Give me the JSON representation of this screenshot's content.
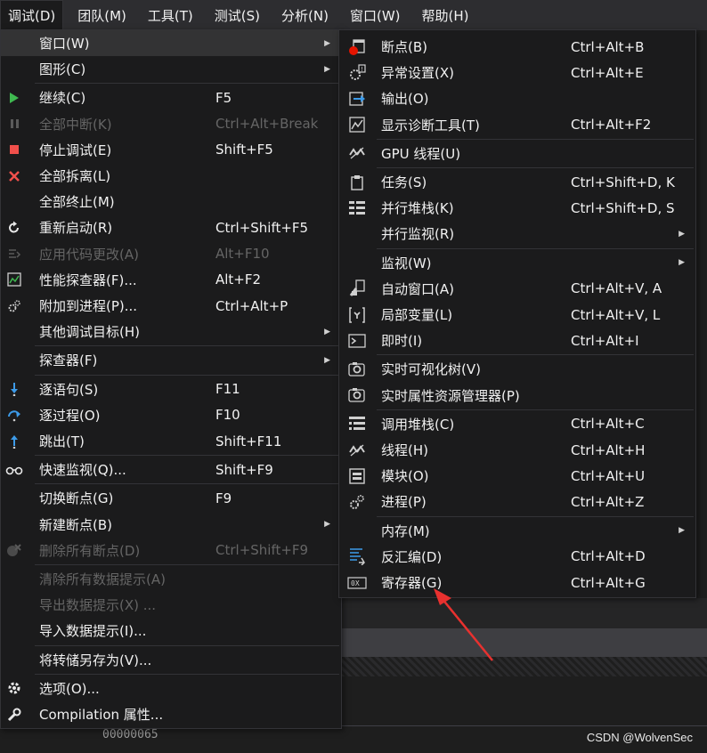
{
  "menubar": {
    "items": [
      "调试(D)",
      "团队(M)",
      "工具(T)",
      "测试(S)",
      "分析(N)",
      "窗口(W)",
      "帮助(H)"
    ]
  },
  "debug_menu": {
    "items": [
      {
        "label": "窗口(W)",
        "shortcut": "",
        "submenu": true,
        "disabled": false,
        "icon": "none"
      },
      {
        "label": "图形(C)",
        "shortcut": "",
        "submenu": true,
        "disabled": false,
        "icon": "none"
      },
      {
        "label": "继续(C)",
        "shortcut": "F5",
        "submenu": false,
        "disabled": false,
        "icon": "continue-icon"
      },
      {
        "label": "全部中断(K)",
        "shortcut": "Ctrl+Alt+Break",
        "submenu": false,
        "disabled": true,
        "icon": "pause-icon"
      },
      {
        "label": "停止调试(E)",
        "shortcut": "Shift+F5",
        "submenu": false,
        "disabled": false,
        "icon": "stop-icon"
      },
      {
        "label": "全部拆离(L)",
        "shortcut": "",
        "submenu": false,
        "disabled": false,
        "icon": "detach-icon"
      },
      {
        "label": "全部终止(M)",
        "shortcut": "",
        "submenu": false,
        "disabled": false,
        "icon": "none"
      },
      {
        "label": "重新启动(R)",
        "shortcut": "Ctrl+Shift+F5",
        "submenu": false,
        "disabled": false,
        "icon": "restart-icon"
      },
      {
        "label": "应用代码更改(A)",
        "shortcut": "Alt+F10",
        "submenu": false,
        "disabled": true,
        "icon": "apply-code-icon"
      },
      {
        "label": "性能探查器(F)...",
        "shortcut": "Alt+F2",
        "submenu": false,
        "disabled": false,
        "icon": "profiler-icon"
      },
      {
        "label": "附加到进程(P)...",
        "shortcut": "Ctrl+Alt+P",
        "submenu": false,
        "disabled": false,
        "icon": "attach-icon"
      },
      {
        "label": "其他调试目标(H)",
        "shortcut": "",
        "submenu": true,
        "disabled": false,
        "icon": "none"
      },
      {
        "label": "探查器(F)",
        "shortcut": "",
        "submenu": true,
        "disabled": false,
        "icon": "none"
      },
      {
        "label": "逐语句(S)",
        "shortcut": "F11",
        "submenu": false,
        "disabled": false,
        "icon": "step-into-icon"
      },
      {
        "label": "逐过程(O)",
        "shortcut": "F10",
        "submenu": false,
        "disabled": false,
        "icon": "step-over-icon"
      },
      {
        "label": "跳出(T)",
        "shortcut": "Shift+F11",
        "submenu": false,
        "disabled": false,
        "icon": "step-out-icon"
      },
      {
        "label": "快速监视(Q)...",
        "shortcut": "Shift+F9",
        "submenu": false,
        "disabled": false,
        "icon": "quickwatch-icon"
      },
      {
        "label": "切换断点(G)",
        "shortcut": "F9",
        "submenu": false,
        "disabled": false,
        "icon": "none"
      },
      {
        "label": "新建断点(B)",
        "shortcut": "",
        "submenu": true,
        "disabled": false,
        "icon": "none"
      },
      {
        "label": "删除所有断点(D)",
        "shortcut": "Ctrl+Shift+F9",
        "submenu": false,
        "disabled": true,
        "icon": "delete-breakpoints-icon"
      },
      {
        "label": "清除所有数据提示(A)",
        "shortcut": "",
        "submenu": false,
        "disabled": true,
        "icon": "none"
      },
      {
        "label": "导出数据提示(X) ...",
        "shortcut": "",
        "submenu": false,
        "disabled": true,
        "icon": "none"
      },
      {
        "label": "导入数据提示(I)...",
        "shortcut": "",
        "submenu": false,
        "disabled": false,
        "icon": "none"
      },
      {
        "label": "将转储另存为(V)...",
        "shortcut": "",
        "submenu": false,
        "disabled": false,
        "icon": "none"
      },
      {
        "label": "选项(O)...",
        "shortcut": "",
        "submenu": false,
        "disabled": false,
        "icon": "gear-icon"
      },
      {
        "label": "Compilation 属性...",
        "shortcut": "",
        "submenu": false,
        "disabled": false,
        "icon": "wrench-icon"
      }
    ]
  },
  "window_submenu": {
    "items": [
      {
        "label": "断点(B)",
        "shortcut": "Ctrl+Alt+B",
        "submenu": false,
        "icon": "breakpoints-icon"
      },
      {
        "label": "异常设置(X)",
        "shortcut": "Ctrl+Alt+E",
        "submenu": false,
        "icon": "exception-settings-icon"
      },
      {
        "label": "输出(O)",
        "shortcut": "",
        "submenu": false,
        "icon": "output-icon"
      },
      {
        "label": "显示诊断工具(T)",
        "shortcut": "Ctrl+Alt+F2",
        "submenu": false,
        "icon": "diagnostic-tools-icon"
      },
      {
        "label": "GPU 线程(U)",
        "shortcut": "",
        "submenu": false,
        "icon": "gpu-threads-icon"
      },
      {
        "label": "任务(S)",
        "shortcut": "Ctrl+Shift+D, K",
        "submenu": false,
        "icon": "tasks-icon"
      },
      {
        "label": "并行堆栈(K)",
        "shortcut": "Ctrl+Shift+D, S",
        "submenu": false,
        "icon": "parallel-stacks-icon"
      },
      {
        "label": "并行监视(R)",
        "shortcut": "",
        "submenu": true,
        "icon": "none"
      },
      {
        "label": "监视(W)",
        "shortcut": "",
        "submenu": true,
        "icon": "none"
      },
      {
        "label": "自动窗口(A)",
        "shortcut": "Ctrl+Alt+V, A",
        "submenu": false,
        "icon": "autos-icon"
      },
      {
        "label": "局部变量(L)",
        "shortcut": "Ctrl+Alt+V, L",
        "submenu": false,
        "icon": "locals-icon"
      },
      {
        "label": "即时(I)",
        "shortcut": "Ctrl+Alt+I",
        "submenu": false,
        "icon": "immediate-icon"
      },
      {
        "label": "实时可视化树(V)",
        "shortcut": "",
        "submenu": false,
        "icon": "live-visual-tree-icon"
      },
      {
        "label": "实时属性资源管理器(P)",
        "shortcut": "",
        "submenu": false,
        "icon": "live-property-explorer-icon"
      },
      {
        "label": "调用堆栈(C)",
        "shortcut": "Ctrl+Alt+C",
        "submenu": false,
        "icon": "call-stack-icon"
      },
      {
        "label": "线程(H)",
        "shortcut": "Ctrl+Alt+H",
        "submenu": false,
        "icon": "threads-icon"
      },
      {
        "label": "模块(O)",
        "shortcut": "Ctrl+Alt+U",
        "submenu": false,
        "icon": "modules-icon"
      },
      {
        "label": "进程(P)",
        "shortcut": "Ctrl+Alt+Z",
        "submenu": false,
        "icon": "processes-icon"
      },
      {
        "label": "内存(M)",
        "shortcut": "",
        "submenu": true,
        "icon": "none"
      },
      {
        "label": "反汇编(D)",
        "shortcut": "Ctrl+Alt+D",
        "submenu": false,
        "icon": "disassembly-icon"
      },
      {
        "label": "寄存器(G)",
        "shortcut": "Ctrl+Alt+G",
        "submenu": false,
        "icon": "registers-icon"
      }
    ]
  },
  "background": {
    "hex_value": "00000065",
    "watermark": "CSDN @WolvenSec"
  },
  "colors": {
    "menu_bg": "#1b1b1c",
    "menubar_bg": "#2d2d30",
    "highlight": "#333334",
    "disabled_text": "#656565",
    "annotation_arrow": "#e8312f"
  }
}
